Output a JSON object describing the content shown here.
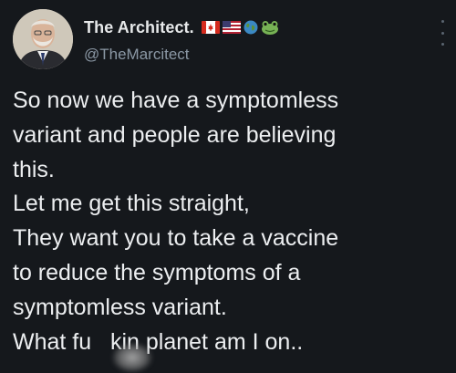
{
  "author": {
    "display_name": "The Architect.",
    "handle": "@TheMarcitect",
    "badges": [
      "canada-flag-icon",
      "us-flag-icon",
      "globe-icon",
      "frog-icon"
    ]
  },
  "tweet": {
    "lines": [
      "So now we have a symptomless",
      "variant and people are believing",
      "this.",
      "Let me get this straight,",
      "They want you to take a vaccine",
      "to reduce the symptoms of a",
      "symptomless variant.",
      "What fu   kin planet am I on.."
    ]
  },
  "colors": {
    "background": "#15181c",
    "text": "#e7e9ea",
    "secondary_text": "#8b98a5"
  }
}
